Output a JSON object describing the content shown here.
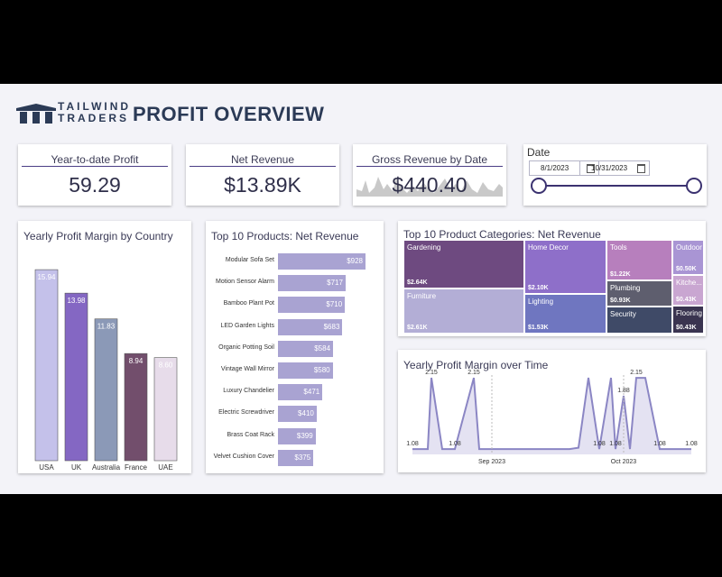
{
  "brand": {
    "line1": "TAILWIND",
    "line2": "TRADERS",
    "logo_color": "#2b3a56"
  },
  "page_title": "PROFIT OVERVIEW",
  "kpis": {
    "ytd_profit": {
      "title": "Year-to-date Profit",
      "value": "59.29"
    },
    "net_revenue": {
      "title": "Net Revenue",
      "value": "$13.89K"
    },
    "gross_revenue": {
      "title": "Gross Revenue by Date",
      "value": "$440.40"
    }
  },
  "date_filter": {
    "label": "Date",
    "start": "8/1/2023",
    "end": "10/31/2023",
    "icon": "calendar-icon"
  },
  "colors": {
    "accent": "#4a3e86",
    "bar_light": "#a9a3d2"
  },
  "margin_by_country": {
    "title": "Yearly Profit Margin by Country"
  },
  "top_products": {
    "title": "Top 10 Products: Net Revenue"
  },
  "categories": {
    "title": "Top 10 Product Categories: Net Revenue",
    "items": [
      {
        "name": "Gardening",
        "value": "$2.64K",
        "color": "#6e4a80"
      },
      {
        "name": "Furniture",
        "value": "$2.61K",
        "color": "#b3aed6"
      },
      {
        "name": "Home Decor",
        "value": "$2.10K",
        "color": "#8e6fc9"
      },
      {
        "name": "Lighting",
        "value": "$1.53K",
        "color": "#6f76c0"
      },
      {
        "name": "Tools",
        "value": "$1.22K",
        "color": "#b77fbd"
      },
      {
        "name": "Plumbing",
        "value": "$0.93K",
        "color": "#5e5e6e"
      },
      {
        "name": "Security",
        "value": "",
        "color": "#3f4a67"
      },
      {
        "name": "Outdoor",
        "value": "$0.50K",
        "color": "#a995d4"
      },
      {
        "name": "Kitche...",
        "value": "$0.43K",
        "color": "#c9a6d1"
      },
      {
        "name": "Flooring",
        "value": "$0.43K",
        "color": "#3a3450"
      }
    ]
  },
  "margin_over_time": {
    "title": "Yearly Profit Margin over Time"
  },
  "chart_data": [
    {
      "type": "bar",
      "title": "Yearly Profit Margin by Country",
      "categories": [
        "USA",
        "UK",
        "Australia",
        "France",
        "UAE"
      ],
      "values": [
        15.94,
        13.98,
        11.83,
        8.94,
        8.6
      ],
      "value_labels": [
        "15.94",
        "13.98",
        "11.83",
        "8.94",
        "8.60"
      ],
      "colors": [
        "#c4c1ea",
        "#8467c3",
        "#8b99b7",
        "#724e6c",
        "#e7dcea"
      ],
      "ylim": [
        0,
        17
      ],
      "grid": false
    },
    {
      "type": "bar",
      "orientation": "horizontal",
      "title": "Top 10 Products: Net Revenue",
      "categories": [
        "Modular Sofa Set",
        "Motion Sensor Alarm",
        "Bamboo Plant Pot",
        "LED Garden Lights",
        "Organic Potting Soil",
        "Vintage Wall Mirror",
        "Luxury Chandelier",
        "Electric Screwdriver",
        "Brass Coat Rack",
        "Velvet Cushion Cover"
      ],
      "values": [
        928,
        717,
        710,
        683,
        584,
        580,
        471,
        410,
        399,
        375
      ],
      "value_labels": [
        "$928",
        "$717",
        "$710",
        "$683",
        "$584",
        "$580",
        "$471",
        "$410",
        "$399",
        "$375"
      ],
      "xlim": [
        0,
        928
      ]
    },
    {
      "type": "area",
      "title": "Yearly Profit Margin over Time",
      "x": [
        "Aug 2023",
        "Aug 2023",
        "Aug 2023",
        "Aug 2023",
        "Aug 2023",
        "Aug 2023",
        "Aug 2023",
        "Sep 2023",
        "Sep 2023",
        "Sep 2023",
        "Sep 2023",
        "Sep 2023",
        "Oct 2023",
        "Oct 2023",
        "Oct 2023",
        "Oct 2023",
        "Oct 2023",
        "Oct 2023",
        "Oct 2023",
        "Oct 2023",
        "Oct 2023"
      ],
      "y": [
        1.08,
        1.08,
        2.15,
        1.08,
        1.08,
        2.15,
        1.08,
        1.08,
        1.08,
        1.08,
        1.1,
        2.15,
        1.08,
        2.15,
        1.08,
        1.88,
        1.08,
        2.15,
        2.15,
        1.08,
        1.08
      ],
      "point_labels": [
        {
          "i": 0,
          "text": "1.08"
        },
        {
          "i": 2,
          "text": "2.15"
        },
        {
          "i": 4,
          "text": "1.08"
        },
        {
          "i": 5,
          "text": "2.15"
        },
        {
          "i": 12,
          "text": "1.08"
        },
        {
          "i": 15,
          "text": "1.88"
        },
        {
          "i": 14,
          "text": "1.08"
        },
        {
          "i": 17,
          "text": "2.15"
        },
        {
          "i": 19,
          "text": "1.08"
        },
        {
          "i": 20,
          "text": "1.08"
        }
      ],
      "x_ticks": [
        "Sep 2023",
        "Oct 2023"
      ],
      "ylim": [
        1.0,
        2.3
      ],
      "colors": [
        "#8b86c4"
      ]
    }
  ]
}
